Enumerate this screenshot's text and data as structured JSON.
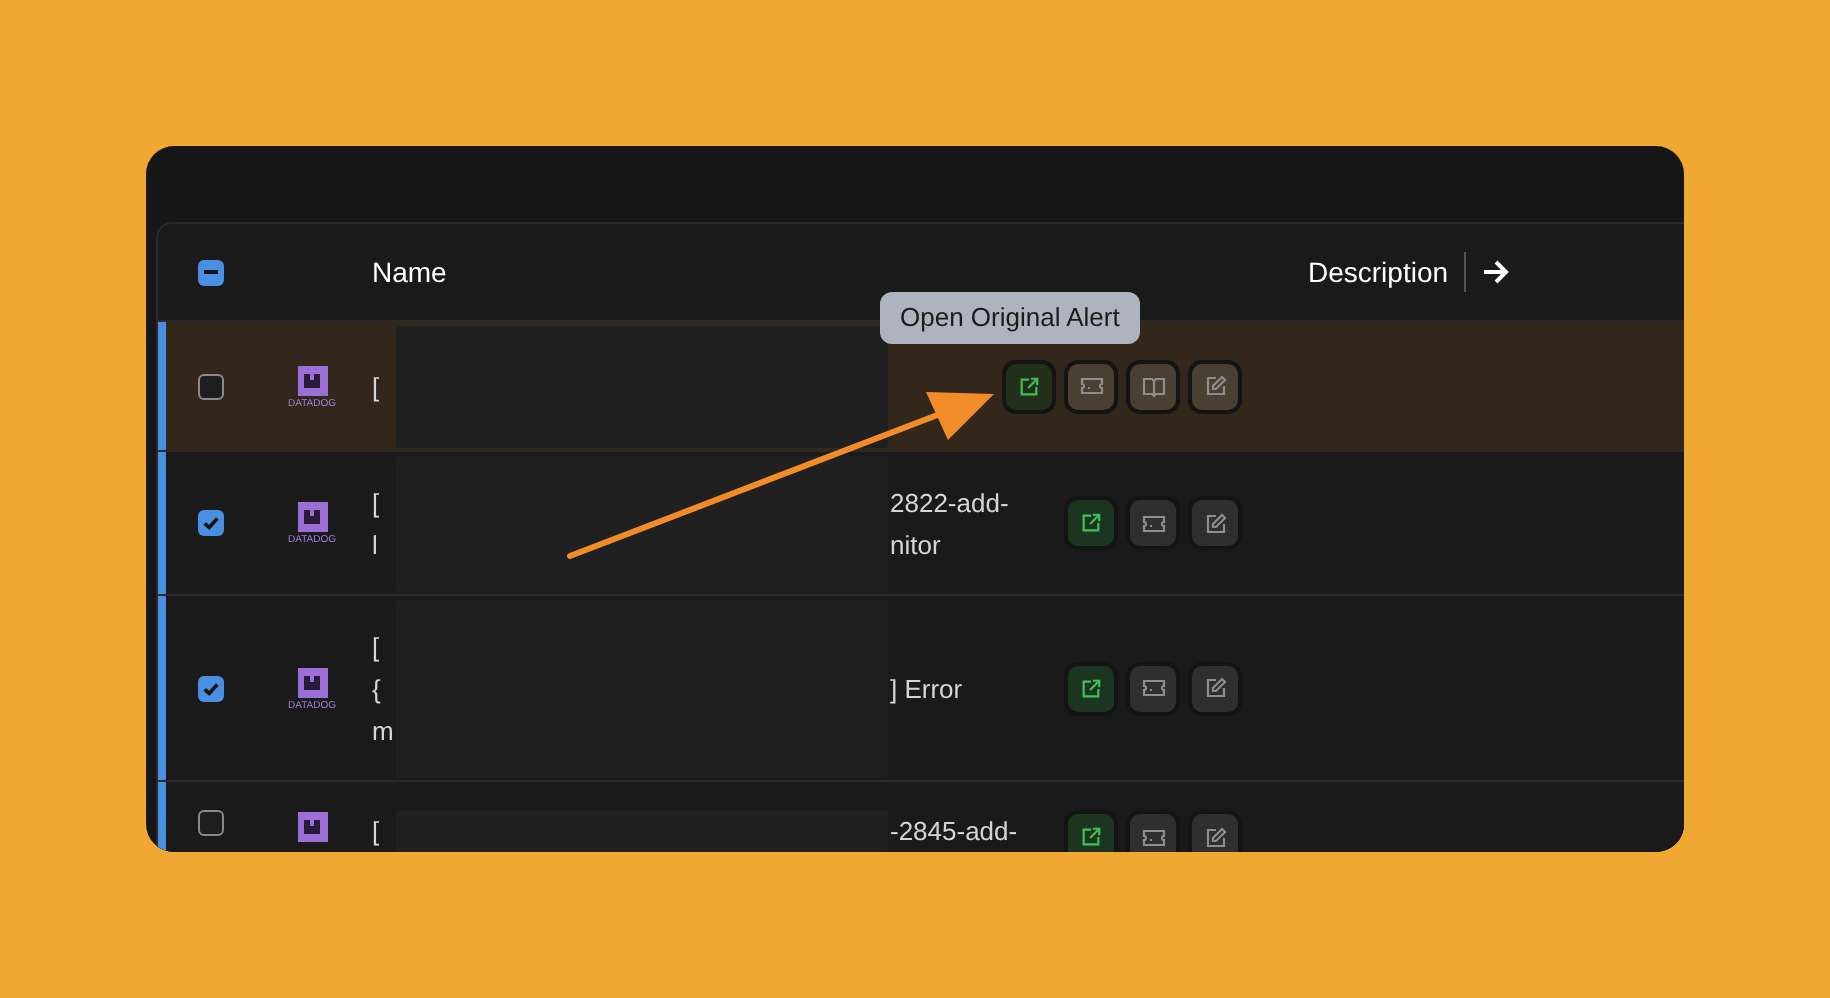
{
  "table": {
    "select_all": {
      "indeterminate": true
    },
    "columns": [
      {
        "label": "Name"
      },
      {
        "label": "Description"
      }
    ],
    "rows": [
      {
        "checked": false,
        "highlighted": true,
        "logo": "DATADOG",
        "name_lines": [
          {
            "start": "["
          }
        ],
        "actions": [
          {
            "kind": "open"
          },
          {
            "kind": "ticket"
          },
          {
            "kind": "book"
          },
          {
            "kind": "edit"
          }
        ]
      },
      {
        "checked": true,
        "highlighted": false,
        "logo": "DATADOG",
        "name_lines": [
          {
            "start": "[",
            "end": "2822-add-"
          },
          {
            "start": "l",
            "end": "nitor"
          }
        ],
        "actions": [
          {
            "kind": "open"
          },
          {
            "kind": "ticket"
          },
          {
            "kind": "edit"
          }
        ]
      },
      {
        "checked": true,
        "highlighted": false,
        "logo": "DATADOG",
        "name_lines": [
          {
            "start": "["
          },
          {
            "start": "{",
            "end": "] Error"
          },
          {
            "start": "m"
          }
        ],
        "actions": [
          {
            "kind": "open"
          },
          {
            "kind": "ticket"
          },
          {
            "kind": "edit"
          }
        ]
      },
      {
        "checked": false,
        "highlighted": false,
        "name_lines": [
          {
            "start": "[",
            "end": "-2845-add-"
          }
        ],
        "actions": [
          {
            "kind": "open"
          },
          {
            "kind": "ticket"
          },
          {
            "kind": "edit"
          }
        ]
      }
    ]
  },
  "tooltip": {
    "text": "Open Original Alert"
  }
}
